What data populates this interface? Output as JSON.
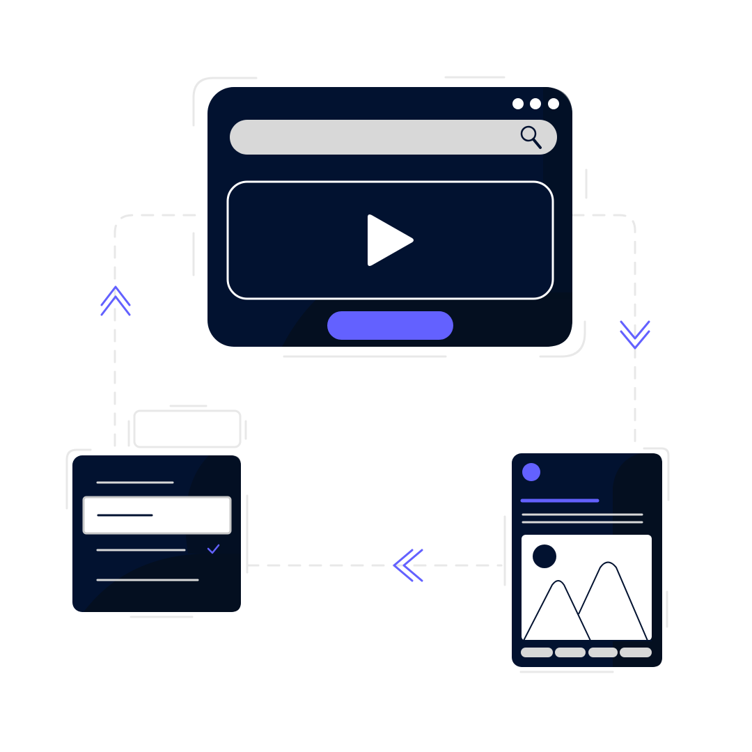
{
  "illustration": {
    "colors": {
      "navy": "#021230",
      "navy_dark": "#040f20",
      "accent": "#6361ff",
      "light_gray": "#d8d8d8",
      "guide_gray": "#e8e8e8",
      "white": "#ffffff"
    },
    "browser_window": {
      "dots": [
        "dot",
        "dot",
        "dot"
      ],
      "search_icon": "search-icon",
      "play_icon": "play-icon",
      "cta_button": "accent-pill-button"
    },
    "list_panel": {
      "rows": 4,
      "selected_row": 2,
      "check_icon": "check-icon"
    },
    "phone_panel": {
      "avatar": "accent-circle",
      "image_icon": "image-placeholder-icon",
      "tabs": 4
    },
    "flow_arrows": [
      "double-chevron-up-icon",
      "double-chevron-down-icon",
      "double-chevron-left-icon"
    ]
  }
}
